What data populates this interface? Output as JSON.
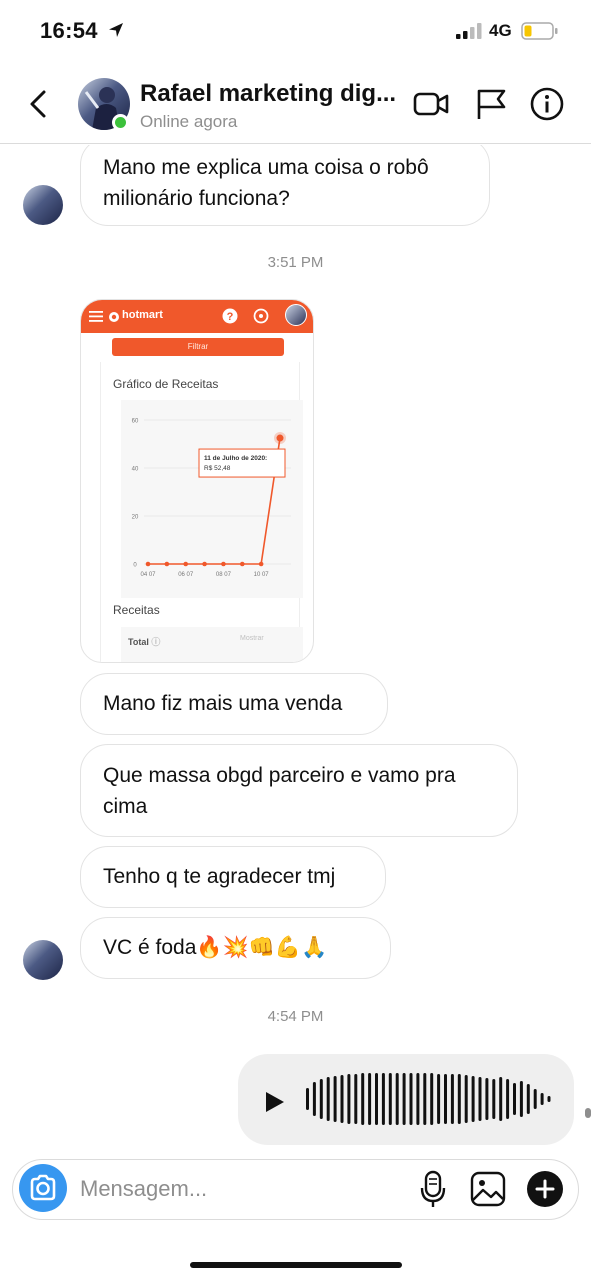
{
  "status_bar": {
    "time": "16:54",
    "network": "4G",
    "icons": [
      "location-arrow-icon",
      "signal-icon",
      "battery-icon"
    ]
  },
  "header": {
    "title": "Rafael marketing dig...",
    "subtitle": "Online agora",
    "icons": [
      "chevron-left-icon",
      "video-call-icon",
      "flag-icon",
      "info-icon"
    ],
    "online_color": "#3cc13b"
  },
  "messages": [
    {
      "type": "text",
      "text_lines": [
        "Mano me explica uma coisa o robô",
        "milionário funciona?"
      ]
    },
    {
      "type": "timestamp",
      "text": "3:51 PM"
    },
    {
      "type": "image",
      "image": {
        "brand": "hotmart",
        "filter_label": "Filtrar",
        "heading": "Gráfico de Receitas",
        "receitas_label": "Receitas",
        "total_label": "Total",
        "mostrar_label": "Mostrar",
        "tooltip_title": "11 de Julho de 2020:",
        "tooltip_value": "R$ 52,48"
      }
    },
    {
      "type": "text",
      "text": "Mano fiz mais uma venda"
    },
    {
      "type": "text",
      "text_lines": [
        "Que massa obgd parceiro e vamo pra",
        "cima"
      ]
    },
    {
      "type": "text",
      "text": "Tenho q te agradecer tmj"
    },
    {
      "type": "text",
      "text": "VC é foda🔥💥👊💪🙏"
    },
    {
      "type": "timestamp",
      "text": "4:54 PM"
    },
    {
      "type": "voice",
      "icons": [
        "play-icon",
        "waveform-icon"
      ]
    }
  ],
  "chart_data": {
    "type": "line",
    "x": [
      "04 07",
      "05 07",
      "06 07",
      "07 07",
      "08 07",
      "09 07",
      "10 07",
      "11 07"
    ],
    "x_tick_labels": [
      "04 07",
      "06 07",
      "08 07",
      "10 07"
    ],
    "values": [
      0,
      0,
      0,
      0,
      0,
      0,
      0,
      52.48
    ],
    "y_ticks": [
      0,
      20,
      40,
      60
    ],
    "ylim": [
      0,
      60
    ],
    "color": "#f0582b",
    "grid": true
  },
  "composer": {
    "placeholder": "Mensagem...",
    "icons": [
      "camera-icon",
      "microphone-icon",
      "gallery-icon",
      "plus-icon"
    ],
    "camera_color": "#3797f0"
  },
  "theme": {
    "accent": "#f0582b",
    "muted_text": "#8e8e8e",
    "bubble_border": "#e3e3e3"
  }
}
